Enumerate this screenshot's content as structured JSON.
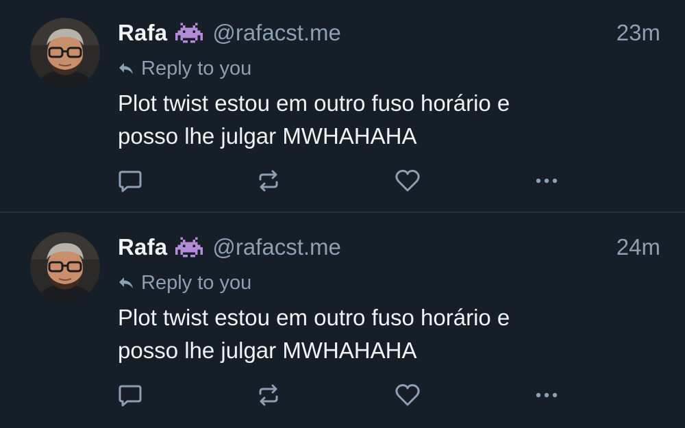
{
  "posts": [
    {
      "author": {
        "display_name": "Rafa",
        "handle": "@rafacst.me",
        "emoji_icon": "alien-monster-icon"
      },
      "timestamp": "23m",
      "reply_label": "Reply to you",
      "text": "Plot twist estou em outro fuso horário e\nposso lhe julgar MWHAHAHA",
      "actions": [
        "comment-icon",
        "repost-icon",
        "like-heart-icon",
        "more-options-icon"
      ]
    },
    {
      "author": {
        "display_name": "Rafa",
        "handle": "@rafacst.me",
        "emoji_icon": "alien-monster-icon"
      },
      "timestamp": "24m",
      "reply_label": "Reply to you",
      "text": "Plot twist estou em outro fuso horário e\nposso lhe julgar MWHAHAHA",
      "actions": [
        "comment-icon",
        "repost-icon",
        "like-heart-icon",
        "more-options-icon"
      ]
    }
  ],
  "colors": {
    "background": "#161e27",
    "divider": "#25313e",
    "primary_text": "#f1f3f5",
    "secondary_text": "#8d9fb1",
    "alien_emoji": "#b58ad6"
  }
}
